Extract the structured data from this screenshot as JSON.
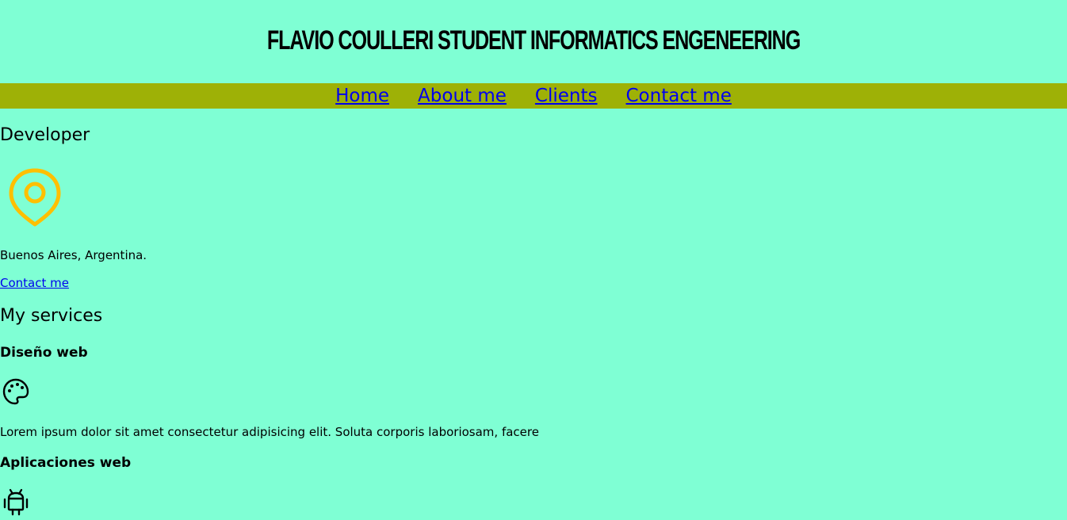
{
  "header": {
    "title": "Flavio Coulleri Student Informatics Engeneering"
  },
  "nav": {
    "items": [
      {
        "label": "Home"
      },
      {
        "label": "About me"
      },
      {
        "label": "Clients"
      },
      {
        "label": "Contact me"
      }
    ]
  },
  "hero": {
    "title": "Developer",
    "icon": "map-pin-icon",
    "icon_color": "#ffbf00",
    "location": "Buenos Aires, Argentina.",
    "contact_link": "Contact me"
  },
  "services": {
    "title": "My services",
    "items": [
      {
        "title": "Diseño web",
        "icon": "palette-icon",
        "text": "Lorem ipsum dolor sit amet consectetur adipisicing elit. Soluta corporis laboriosam, facere"
      },
      {
        "title": "Aplicaciones web",
        "icon": "android-icon"
      }
    ]
  },
  "colors": {
    "background": "#7fffd4",
    "nav_background": "#9eb106",
    "link": "#0000ee"
  }
}
